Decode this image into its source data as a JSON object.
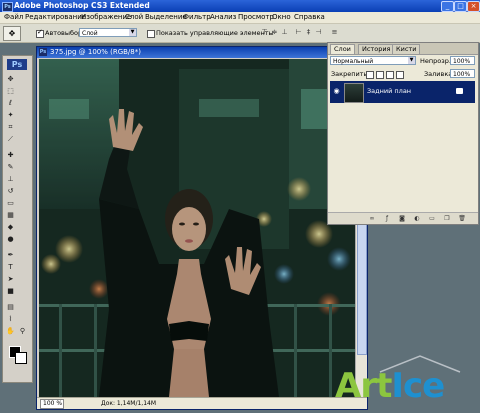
{
  "window": {
    "title": "Adobe Photoshop CS3 Extended"
  },
  "window_buttons": {
    "minimize": "_",
    "maximize": "□",
    "close": "×"
  },
  "menu": [
    "Файл",
    "Редактирование",
    "Изображение",
    "Слой",
    "Выделение",
    "Фильтр",
    "Анализ",
    "Просмотр",
    "Окно",
    "Справка"
  ],
  "options_bar": {
    "auto_select_label": "Автовыбор:",
    "auto_select_value": "Слой",
    "show_controls_label": "Показать управляющие элементы",
    "tool_icon": "move-tool-icon"
  },
  "document": {
    "title": "375.jpg @ 100% (RGB/8*)",
    "zoom": "100 %",
    "doc_info": "Док: 1,14M/1,14M",
    "logo": "Ps"
  },
  "layers_panel": {
    "tabs": [
      "Слои",
      "История",
      "Кисти"
    ],
    "active_tab": "Слои",
    "blend_mode": "Нормальный",
    "opacity_label": "Непрозр.:",
    "opacity_value": "100%",
    "lock_label": "Закрепить:",
    "fill_label": "Заливка:",
    "fill_value": "100%",
    "layers": [
      {
        "name": "Задний план",
        "visible": true,
        "locked": true
      }
    ]
  },
  "toolbox": {
    "logo": "Ps"
  },
  "watermark": {
    "part1": "Art",
    "part2": "Ice"
  },
  "colors": {
    "title_bar": "#0b3fb5",
    "selected_layer": "#0a246a",
    "watermark_green": "#8cc63f",
    "watermark_blue": "#1e90d0"
  }
}
